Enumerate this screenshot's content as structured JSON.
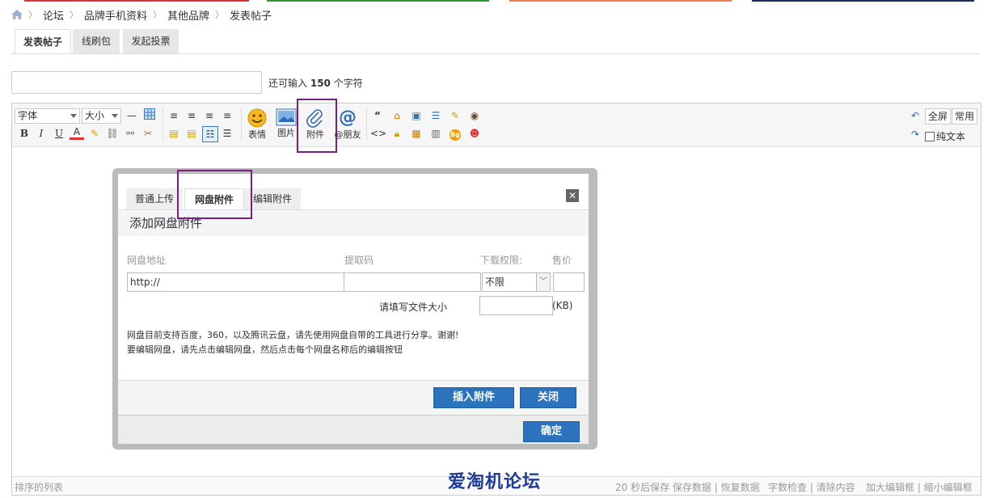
{
  "breadcrumb": {
    "items": [
      "论坛",
      "品牌手机资料",
      "其他品牌",
      "发表帖子"
    ]
  },
  "tabs": [
    {
      "label": "发表帖子",
      "active": true
    },
    {
      "label": "线刷包",
      "active": false
    },
    {
      "label": "发起投票",
      "active": false
    }
  ],
  "title_field": {
    "value": "",
    "remaining_prefix": "还可输入",
    "remaining_count": "150",
    "remaining_suffix": "个字符"
  },
  "toolbar": {
    "font_select": "字体",
    "size_select": "大小",
    "emoji_label": "表情",
    "image_label": "图片",
    "attach_label": "附件",
    "at_label": "@朋友",
    "fullscreen_label": "全屏",
    "common_label": "常用",
    "plain_text_label": "纯文本"
  },
  "dialog": {
    "tabs": [
      "普通上传",
      "网盘附件",
      "编辑附件"
    ],
    "active_tab": "网盘附件",
    "heading": "添加网盘附件",
    "col_address": "网盘地址",
    "col_code": "提取码",
    "col_permission": "下载权限:",
    "col_price": "售价",
    "address_value": "http://",
    "permission_value": "不限",
    "size_label": "请填写文件大小",
    "size_unit": "(KB)",
    "note_line1": "网盘目前支持百度，360，以及腾讯云盘，请先使用网盘自带的工具进行分享。谢谢!",
    "note_line2": "要编辑网盘，请先点击编辑网盘，然后点击每个网盘名称后的编辑按钮",
    "insert_button": "插入附件",
    "close_button": "关闭",
    "confirm_button": "确定"
  },
  "statusbar": {
    "left": "排序的列表",
    "autosave": "20 秒后保存 保存数据 | 恢复数据",
    "check": "字数检查 | 清除内容",
    "resize": "加大编辑框 | 缩小编辑框"
  },
  "watermark": "爱淘机论坛",
  "colors": {
    "accent_blue": "#2b73bd",
    "highlight_purple": "#7a1e84"
  }
}
